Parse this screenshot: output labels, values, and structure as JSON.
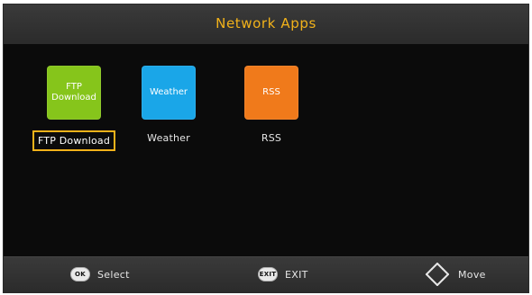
{
  "header": {
    "title": "Network Apps"
  },
  "apps": [
    {
      "tile_text": "FTP\nDownload",
      "label": "FTP Download",
      "tile_color": "#86c51b",
      "selected": true
    },
    {
      "tile_text": "Weather",
      "label": "Weather",
      "tile_color": "#1aa6e8",
      "selected": false
    },
    {
      "tile_text": "RSS",
      "label": "RSS",
      "tile_color": "#f07a1b",
      "selected": false
    }
  ],
  "footer": {
    "select": {
      "icon_text": "OK",
      "label": "Select"
    },
    "exit": {
      "icon_text": "EXIT",
      "label": "EXIT"
    },
    "move": {
      "icon": "dpad-icon",
      "label": "Move"
    }
  },
  "colors": {
    "accent": "#f2b21a",
    "background": "#0b0b0b",
    "bar": "#333333",
    "text": "#e6e6e6"
  }
}
